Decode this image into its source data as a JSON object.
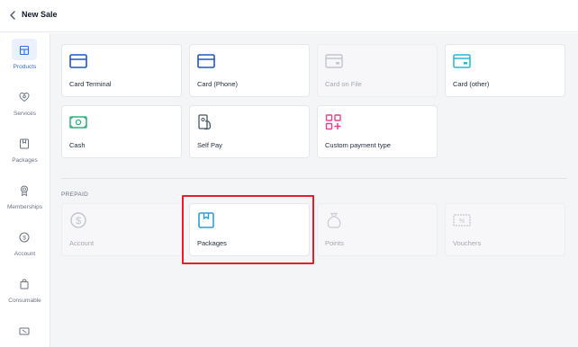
{
  "header": {
    "title": "New Sale",
    "back_icon": "chevron-left-icon"
  },
  "sidebar": {
    "items": [
      {
        "label": "Products",
        "icon": "store-icon",
        "active": true
      },
      {
        "label": "Services",
        "icon": "services-icon",
        "active": false
      },
      {
        "label": "Packages",
        "icon": "package-icon",
        "active": false
      },
      {
        "label": "Memberships",
        "icon": "membership-icon",
        "active": false
      },
      {
        "label": "Account",
        "icon": "account-icon",
        "active": false
      },
      {
        "label": "Consumable",
        "icon": "consumable-icon",
        "active": false
      },
      {
        "label": "",
        "icon": "voucher-icon",
        "active": false
      }
    ],
    "active_color": "#2f6fe4"
  },
  "payment_methods": [
    {
      "label": "Card Terminal",
      "icon": "card-terminal-icon",
      "color": "#1e56c7",
      "enabled": true
    },
    {
      "label": "Card (Phone)",
      "icon": "card-phone-icon",
      "color": "#1e56c7",
      "enabled": true
    },
    {
      "label": "Card on File",
      "icon": "card-on-file-icon",
      "color": "#c2c5cc",
      "enabled": false
    },
    {
      "label": "Card (other)",
      "icon": "card-other-icon",
      "color": "#26b5d9",
      "enabled": true
    },
    {
      "label": "Cash",
      "icon": "cash-icon",
      "color": "#2fb37a",
      "enabled": true
    },
    {
      "label": "Self Pay",
      "icon": "self-pay-icon",
      "color": "#4b5563",
      "enabled": true
    },
    {
      "label": "Custom payment type",
      "icon": "custom-payment-icon",
      "color": "#ec3f8e",
      "enabled": true
    }
  ],
  "prepaid": {
    "section_label": "PREPAID",
    "items": [
      {
        "label": "Account",
        "icon": "dollar-circle-icon",
        "color": "#c2c5cc",
        "enabled": false
      },
      {
        "label": "Packages",
        "icon": "package-box-icon",
        "color": "#2a9fd6",
        "enabled": true,
        "highlighted": true
      },
      {
        "label": "Points",
        "icon": "points-bag-icon",
        "color": "#c9ccd2",
        "enabled": false
      },
      {
        "label": "Vouchers",
        "icon": "voucher-ticket-icon",
        "color": "#c2c5cc",
        "enabled": false
      }
    ]
  },
  "highlight_color": "#e0202a"
}
